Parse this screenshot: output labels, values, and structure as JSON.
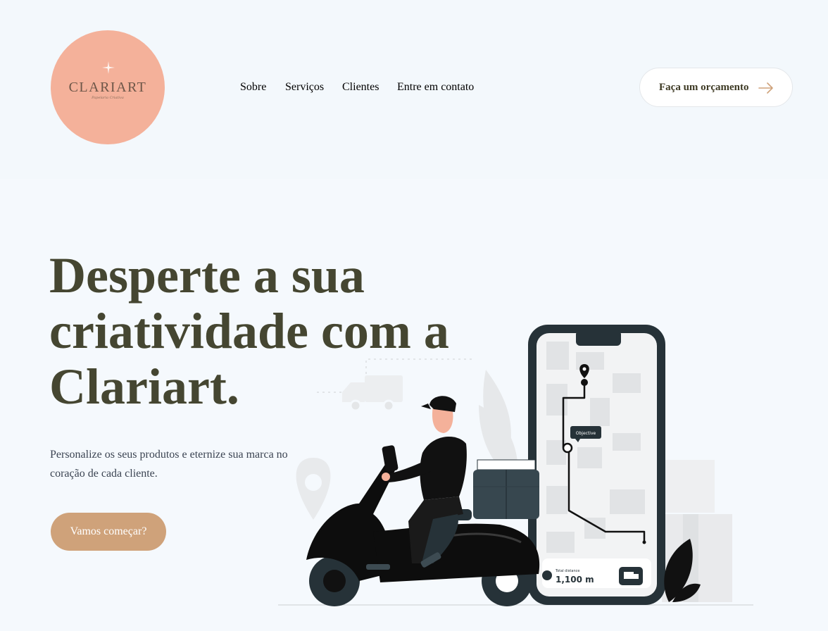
{
  "logo": {
    "name": "CLARIART",
    "tagline": "Papelaria Criativa"
  },
  "nav": {
    "items": [
      "Sobre",
      "Serviços",
      "Clientes",
      "Entre em contato"
    ]
  },
  "header": {
    "quote_button_label": "Faça um orçamento"
  },
  "hero": {
    "title": "Desperte a sua criatividade com a Clariart.",
    "description": "Personalize os seus produtos e eternize sua marca no coração de cada cliente.",
    "cta_label": "Vamos começar?"
  },
  "illustration": {
    "map_tooltip": "Objective",
    "distance_label": "Total distance",
    "distance_value": "1,100 m"
  },
  "colors": {
    "background": "#f5f9fd",
    "logo_circle": "#f4b19a",
    "heading": "#454631",
    "cta": "#cfa27a"
  }
}
